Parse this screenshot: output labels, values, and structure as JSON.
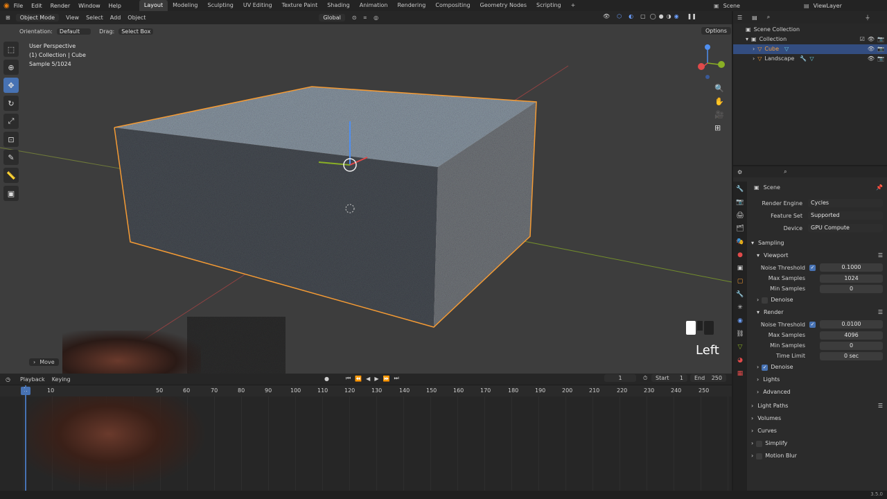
{
  "topbar": {
    "menus": [
      "File",
      "Edit",
      "Render",
      "Window",
      "Help"
    ],
    "workspaces": [
      "Layout",
      "Modeling",
      "Sculpting",
      "UV Editing",
      "Texture Paint",
      "Shading",
      "Animation",
      "Rendering",
      "Compositing",
      "Geometry Nodes",
      "Scripting"
    ],
    "active_workspace": "Layout",
    "add_tab": "+",
    "scene": "Scene",
    "view_layer": "ViewLayer"
  },
  "viewport_header": {
    "mode": "Object Mode",
    "menus": [
      "View",
      "Select",
      "Add",
      "Object"
    ],
    "transform": "Global",
    "orientation_label": "Orientation:",
    "orientation_value": "Default",
    "drag_label": "Drag:",
    "drag_value": "Select Box",
    "options": "Options"
  },
  "viewport": {
    "view_name": "User Perspective",
    "collection_info": "(1) Collection | Cube",
    "sample_info": "Sample 5/1024",
    "key_overlay": "Left",
    "last_op": "Move"
  },
  "timeline": {
    "playback": "Playback",
    "keying": "Keying",
    "current_frame": "1",
    "start_label": "Start",
    "start": "1",
    "end_label": "End",
    "end": "250",
    "ticks": [
      "10",
      "50",
      "60",
      "70",
      "80",
      "90",
      "100",
      "110",
      "120",
      "130",
      "140",
      "150",
      "160",
      "170",
      "180",
      "190",
      "200",
      "210",
      "220",
      "230",
      "240",
      "250"
    ],
    "playhead": "1"
  },
  "outliner": {
    "title": "Scene Collection",
    "items": [
      {
        "label": "Collection"
      },
      {
        "label": "Cube"
      },
      {
        "label": "Landscape"
      }
    ]
  },
  "properties": {
    "context": "Scene",
    "render_engine_label": "Render Engine",
    "render_engine": "Cycles",
    "feature_set_label": "Feature Set",
    "feature_set": "Supported",
    "device_label": "Device",
    "device": "GPU Compute",
    "sampling": "Sampling",
    "viewport": {
      "title": "Viewport",
      "noise_label": "Noise Threshold",
      "noise": "0.1000",
      "max_label": "Max Samples",
      "max": "1024",
      "min_label": "Min Samples",
      "min": "0",
      "denoise": "Denoise"
    },
    "render": {
      "title": "Render",
      "noise_label": "Noise Threshold",
      "noise": "0.0100",
      "max_label": "Max Samples",
      "max": "4096",
      "min_label": "Min Samples",
      "min": "0",
      "time_label": "Time Limit",
      "time": "0 sec",
      "denoise": "Denoise"
    },
    "subsections": [
      "Lights",
      "Advanced"
    ],
    "panels": [
      "Light Paths",
      "Volumes",
      "Curves",
      "Simplify",
      "Motion Blur"
    ]
  },
  "status": {
    "version": "3.5.0"
  },
  "colors": {
    "accent": "#4772b3",
    "selection_outline": "#f59b34",
    "x_axis": "#c94646",
    "y_axis": "#8ab025"
  }
}
